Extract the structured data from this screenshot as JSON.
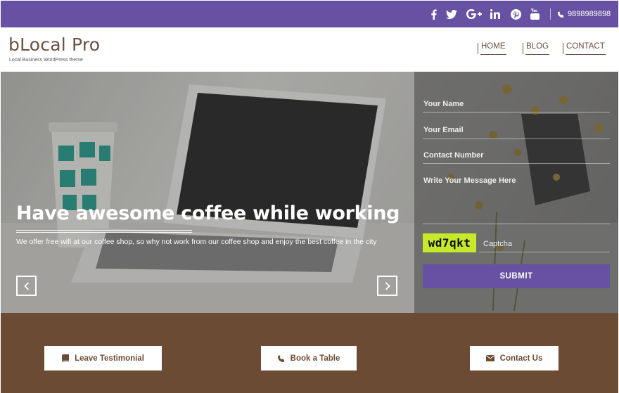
{
  "topbar": {
    "social": [
      {
        "name": "facebook-icon"
      },
      {
        "name": "twitter-icon"
      },
      {
        "name": "google-plus-icon"
      },
      {
        "name": "linkedin-icon"
      },
      {
        "name": "pinterest-icon"
      },
      {
        "name": "youtube-icon"
      }
    ],
    "phone": "9898989898"
  },
  "header": {
    "logo": "bLocal Pro",
    "tagline": "Local Business WordPress theme",
    "nav": [
      "HOME",
      "BLOG",
      "CONTACT"
    ]
  },
  "hero": {
    "headline": "Have awesome coffee while working",
    "subtext": "We offer free wifi at our coffee shop, so why not work from our coffee shop and enjoy the best coffee in the city",
    "prev_icon": "chevron-left-icon",
    "next_icon": "chevron-right-icon"
  },
  "form": {
    "name_placeholder": "Your Name",
    "email_placeholder": "Your Email",
    "phone_placeholder": "Contact Number",
    "message_placeholder": "Write Your Message Here",
    "captcha_code": "wd7qkt",
    "captcha_placeholder": "Captcha",
    "submit_label": "SUBMIT"
  },
  "cta": {
    "testimonial": "Leave Testimonial",
    "book": "Book a Table",
    "contact": "Contact Us"
  },
  "colors": {
    "brand_purple": "#6651a2",
    "brand_brown": "#6c4b34",
    "captcha_green": "#c6ea2b"
  }
}
